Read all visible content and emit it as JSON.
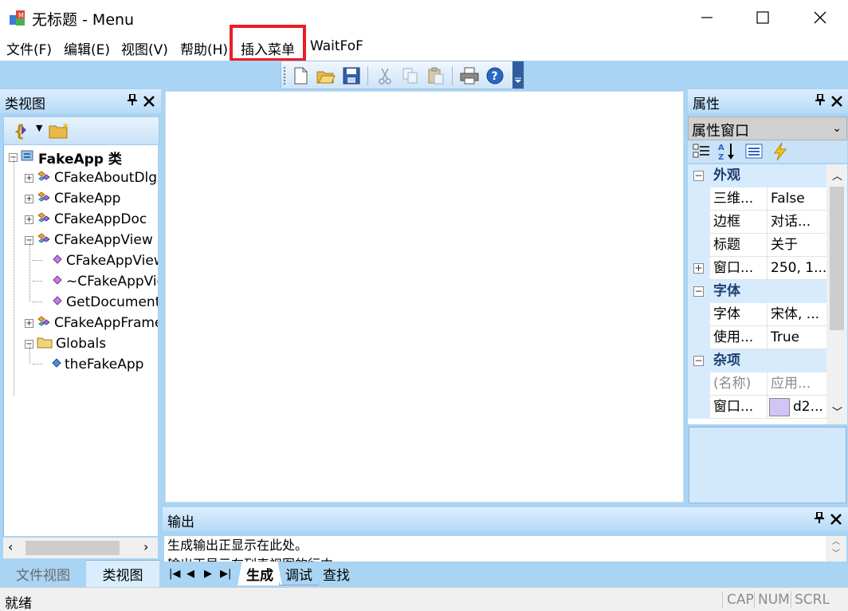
{
  "window": {
    "title": "无标题 - Menu"
  },
  "menubar": {
    "items": [
      "文件(F)",
      "编辑(E)",
      "视图(V)",
      "帮助(H)",
      "插入菜单",
      "WaitFoF"
    ]
  },
  "toolbar": {
    "buttons": [
      "new-icon",
      "open-icon",
      "save-icon",
      "cut-icon",
      "copy-icon",
      "paste-icon",
      "print-icon",
      "help-icon"
    ]
  },
  "class_view": {
    "title": "类视图",
    "tree": [
      {
        "label": "FakeApp 类",
        "icon": "class-view-root-icon",
        "bold": true
      },
      {
        "label": "CFakeAboutDlg",
        "icon": "class-icon"
      },
      {
        "label": "CFakeApp",
        "icon": "class-icon"
      },
      {
        "label": "CFakeAppDoc",
        "icon": "class-icon"
      },
      {
        "label": "CFakeAppView",
        "icon": "class-icon"
      },
      {
        "label": "CFakeAppView",
        "icon": "method-icon"
      },
      {
        "label": "~CFakeAppView",
        "icon": "method-icon"
      },
      {
        "label": "GetDocument",
        "icon": "method-icon"
      },
      {
        "label": "CFakeAppFrame",
        "icon": "class-icon"
      },
      {
        "label": "Globals",
        "icon": "folder-icon"
      },
      {
        "label": "theFakeApp",
        "icon": "variable-icon"
      }
    ],
    "tabs": [
      "文件视图",
      "类视图"
    ]
  },
  "properties": {
    "title": "属性",
    "combo": "属性窗口",
    "categories": {
      "appearance": "外观",
      "font": "字体",
      "misc": "杂项"
    },
    "rows": [
      {
        "name": "三维...",
        "value": "False"
      },
      {
        "name": "边框",
        "value": "对话..."
      },
      {
        "name": "标题",
        "value": "关于"
      },
      {
        "name": "窗口...",
        "value": "250, 1..."
      },
      {
        "name": "字体",
        "value": "宋体, ..."
      },
      {
        "name": "使用...",
        "value": "True"
      },
      {
        "name": "(名称)",
        "value": "应用..."
      },
      {
        "name": "窗口...",
        "value": "d2..."
      }
    ],
    "swatch_color": "#d2c4f4"
  },
  "output": {
    "title": "输出",
    "lines": [
      "生成输出正显示在此处。",
      "输出正显示在列表视图的行中"
    ],
    "tabs": [
      "生成",
      "调试",
      "查找"
    ]
  },
  "statusbar": {
    "text": "就绪",
    "indicators": [
      "CAP",
      "NUM",
      "SCRL"
    ]
  },
  "colors": {
    "accent_blue": "#a9d4f3",
    "highlight_red": "#ee1c24",
    "category_text": "#1d3f73"
  }
}
